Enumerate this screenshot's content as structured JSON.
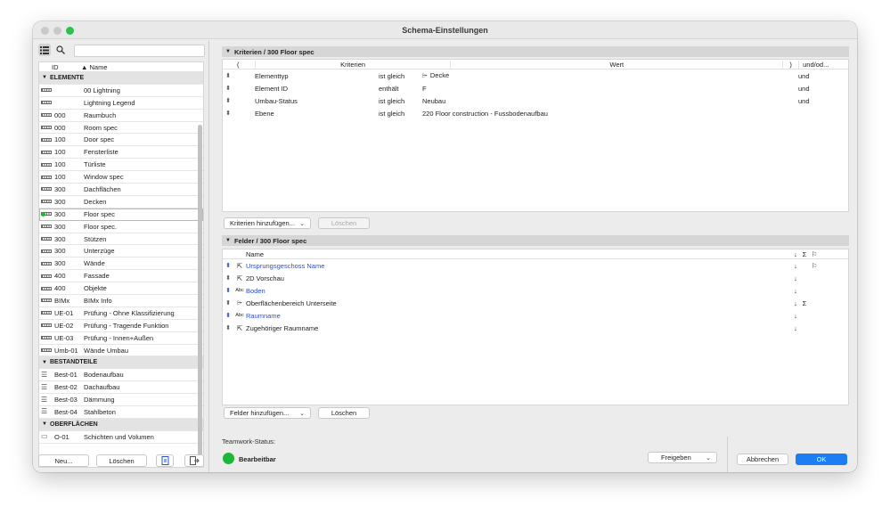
{
  "window": {
    "title": "Schema-Einstellungen"
  },
  "left": {
    "columns": {
      "id": "ID",
      "name": "▲ Name"
    },
    "groups": [
      {
        "label": "ELEMENTE",
        "items": [
          {
            "id": "",
            "name": "00 Lightning"
          },
          {
            "id": "",
            "name": "Lightning Legend"
          },
          {
            "id": "000",
            "name": "Raumbuch"
          },
          {
            "id": "000",
            "name": "Room spec"
          },
          {
            "id": "100",
            "name": "Door spec"
          },
          {
            "id": "100",
            "name": "Fensterliste"
          },
          {
            "id": "100",
            "name": "Türliste"
          },
          {
            "id": "100",
            "name": "Window spec"
          },
          {
            "id": "300",
            "name": "Dachflächen"
          },
          {
            "id": "300",
            "name": "Decken"
          },
          {
            "id": "300",
            "name": "Floor spec",
            "selected": true
          },
          {
            "id": "300",
            "name": "Floor spec."
          },
          {
            "id": "300",
            "name": "Stützen"
          },
          {
            "id": "300",
            "name": "Unterzüge"
          },
          {
            "id": "300",
            "name": "Wände"
          },
          {
            "id": "400",
            "name": "Fassade"
          },
          {
            "id": "400",
            "name": "Objekte"
          },
          {
            "id": "BIMx",
            "name": "BIMx Info"
          },
          {
            "id": "UE-01",
            "name": "Prüfung - Ohne Klassifizierung"
          },
          {
            "id": "UE-02",
            "name": "Prüfung - Tragende Funktion"
          },
          {
            "id": "UE-03",
            "name": "Prüfung - Innen+Außen"
          },
          {
            "id": "Umb-01",
            "name": "Wände Umbau"
          }
        ]
      },
      {
        "label": "BESTANDTEILE",
        "items": [
          {
            "id": "Best-01",
            "name": "Bodenaufbau"
          },
          {
            "id": "Best-02",
            "name": "Dachaufbau"
          },
          {
            "id": "Best-03",
            "name": "Dämmung"
          },
          {
            "id": "Best-04",
            "name": "Stahlbeton"
          }
        ]
      },
      {
        "label": "OBERFLÄCHEN",
        "items": [
          {
            "id": "O-01",
            "name": "Schichten und Volumen"
          }
        ]
      }
    ],
    "buttons": {
      "new": "Neu...",
      "delete": "Löschen"
    }
  },
  "criteria": {
    "header": "Kriterien / 300 Floor spec",
    "columns": {
      "open": "(",
      "criteria": "Kriterien",
      "value": "Wert",
      "close": ")",
      "logic": "und/od..."
    },
    "rows": [
      {
        "criterion": "Elementtyp",
        "op": "ist gleich",
        "value": "Decke",
        "logic": "und"
      },
      {
        "criterion": "Element ID",
        "op": "enthält",
        "value": "F",
        "logic": "und"
      },
      {
        "criterion": "Umbau-Status",
        "op": "ist gleich",
        "value": "Neubau",
        "logic": "und"
      },
      {
        "criterion": "Ebene",
        "op": "ist gleich",
        "value": "220 Floor construction - Fussbodenaufbau",
        "logic": ""
      }
    ],
    "add_button": "Kriterien hinzufügen...",
    "delete_button": "Löschen"
  },
  "fields": {
    "header": "Felder / 300 Floor spec",
    "columns": {
      "name": "Name"
    },
    "rows": [
      {
        "icon": "cursor",
        "name": "Ursprungsgeschoss Name",
        "blue": true,
        "sort": "↓",
        "sum": "",
        "pin": true
      },
      {
        "icon": "cursor",
        "name": "2D Vorschau",
        "blue": false,
        "sort": "↓",
        "sum": "",
        "pin": false
      },
      {
        "icon": "abc",
        "name": "Boden",
        "blue": true,
        "sort": "↓",
        "sum": "",
        "pin": false
      },
      {
        "icon": "shape",
        "name": "Oberflächenbereich Unterseite",
        "blue": false,
        "sort": "↓",
        "sum": "Σ",
        "pin": false
      },
      {
        "icon": "abc",
        "name": "Raumname",
        "blue": true,
        "sort": "↓",
        "sum": "",
        "pin": false
      },
      {
        "icon": "cursor",
        "name": "Zugehöriger Raumname",
        "blue": false,
        "sort": "↓",
        "sum": "",
        "pin": false
      }
    ],
    "header_icons": {
      "sort": "↓",
      "sum": "Σ"
    },
    "add_button": "Felder hinzufügen...",
    "delete_button": "Löschen"
  },
  "teamwork": {
    "label": "Teamwork-Status:",
    "status": "Bearbeitbar",
    "status_color": "#1fb53a",
    "release_button": "Freigeben"
  },
  "footer": {
    "cancel": "Abbrechen",
    "ok": "OK"
  },
  "colors": {
    "accent": "#1d7df2",
    "link": "#2a4fd1"
  }
}
